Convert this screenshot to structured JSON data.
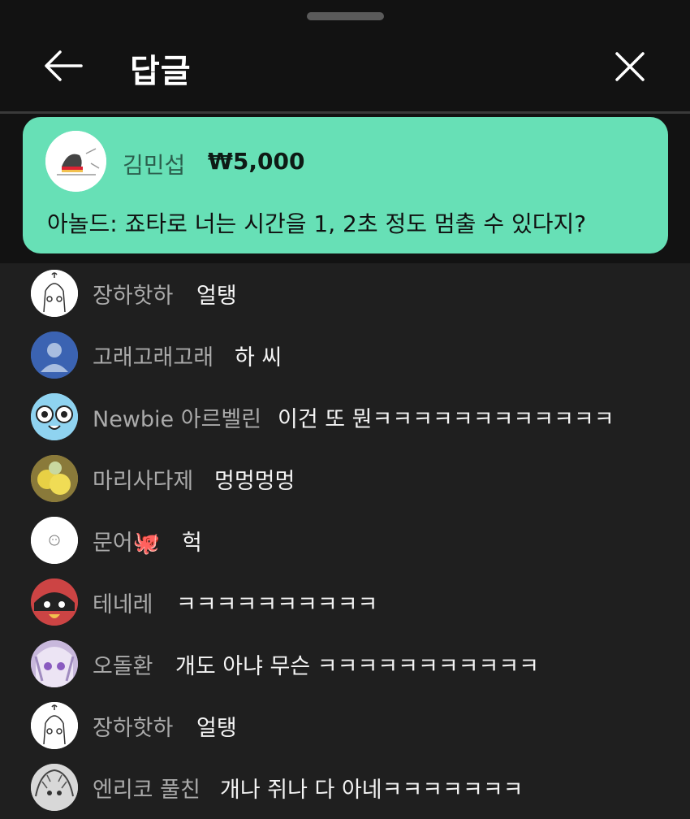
{
  "header": {
    "title": "답글"
  },
  "super_chat": {
    "author": "김민섭",
    "amount": "₩5,000",
    "message": "아놀드: 죠타로 너는 시간을 1, 2초 정도 멈출 수 있다지?",
    "card_color": "#67e0b6"
  },
  "replies": [
    {
      "author": "장하핫하",
      "message": "얼탱"
    },
    {
      "author": "고래고래고래",
      "message": "하 씨"
    },
    {
      "author": "Newbie 아르벨린",
      "message": "이건 또 뭔ㅋㅋㅋㅋㅋㅋㅋㅋㅋㅋㅋㅋ"
    },
    {
      "author": "마리사다제",
      "message": "멍멍멍멍"
    },
    {
      "author": "문어🐙",
      "message": "헉"
    },
    {
      "author": "테네레",
      "message": "ㅋㅋㅋㅋㅋㅋㅋㅋㅋㅋ"
    },
    {
      "author": "오돌환",
      "message": "개도 아냐 무슨 ㅋㅋㅋㅋㅋㅋㅋㅋㅋㅋㅋ"
    },
    {
      "author": "장하핫하",
      "message": "얼탱"
    },
    {
      "author": "엔리코 풀친",
      "message": "개나 쥐나 다 아네ㅋㅋㅋㅋㅋㅋㅋ"
    }
  ]
}
